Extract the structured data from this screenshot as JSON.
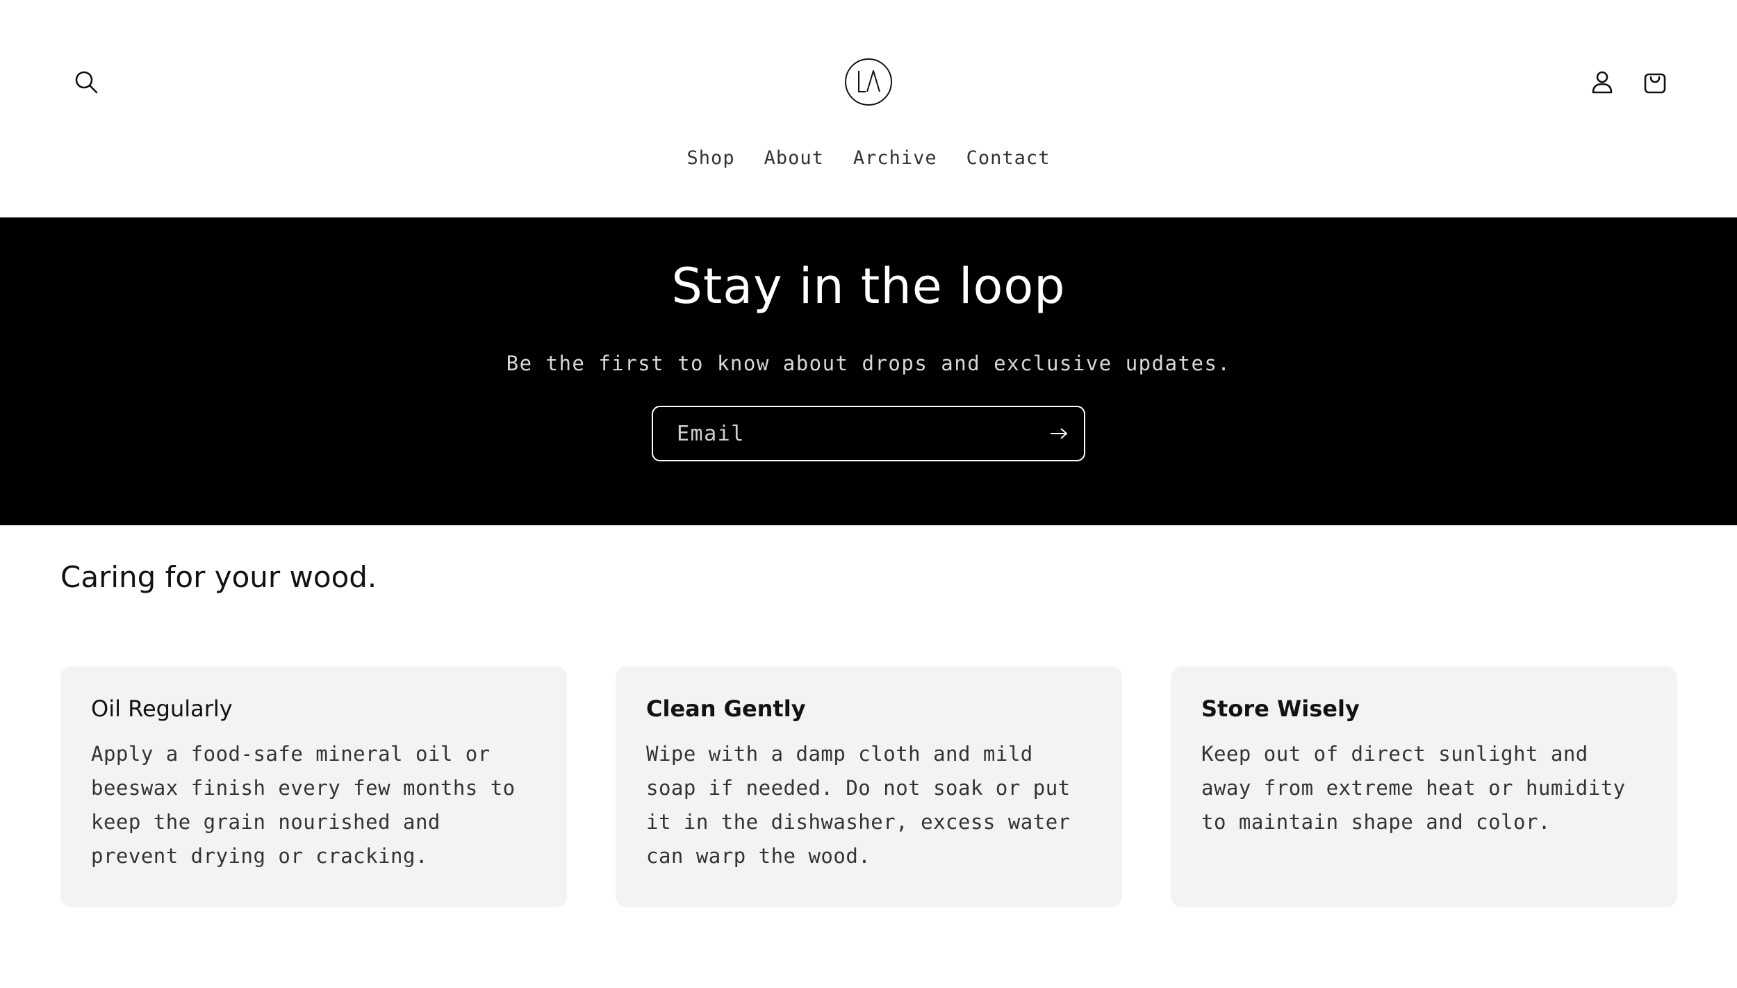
{
  "header": {
    "logo_text": "LA",
    "nav": [
      "Shop",
      "About",
      "Archive",
      "Contact"
    ],
    "icons": [
      "search-icon",
      "account-icon",
      "cart-icon"
    ]
  },
  "newsletter": {
    "title": "Stay in the loop",
    "subtitle": "Be the first to know about drops and exclusive updates.",
    "email_placeholder": "Email",
    "background": "#000000"
  },
  "care": {
    "title": "Caring for your wood.",
    "cards": [
      {
        "title": "Oil Regularly",
        "body": "Apply a food-safe mineral oil or beeswax finish every few months to keep the grain nourished and prevent drying or cracking."
      },
      {
        "title": "Clean Gently",
        "body": "Wipe with a damp cloth and mild soap if needed. Do not soak or put it in the dishwasher, excess water can warp the wood."
      },
      {
        "title": "Store Wisely",
        "body": "Keep out of direct sunlight and away from extreme heat or humidity to maintain shape and color."
      }
    ]
  }
}
